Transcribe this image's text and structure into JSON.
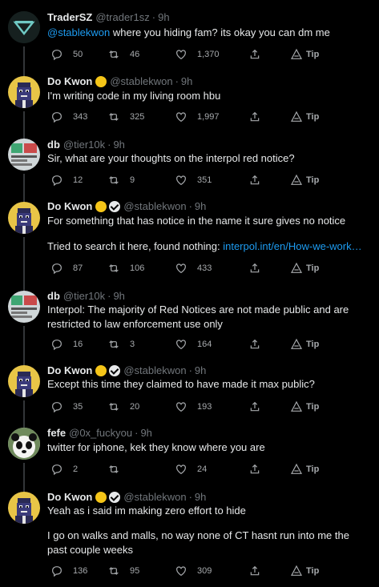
{
  "tweets": [
    {
      "name": "TraderSZ",
      "handle": "@trader1sz",
      "time": "9h",
      "avatar": "v-logo",
      "gold_badge": false,
      "verified": false,
      "mention": "@stablekwon",
      "text": " where you hiding fam? its okay you can dm me",
      "replies": "50",
      "retweets": "46",
      "likes": "1,370",
      "tip": "Tip"
    },
    {
      "name": "Do Kwon",
      "handle": "@stablekwon",
      "time": "9h",
      "avatar": "pixel-punk",
      "gold_badge": true,
      "verified": false,
      "text": "I'm writing code in my living room hbu",
      "replies": "343",
      "retweets": "325",
      "likes": "1,997",
      "tip": "Tip"
    },
    {
      "name": "db",
      "handle": "@tier10k",
      "time": "9h",
      "avatar": "db-screen",
      "text": "Sir, what are your thoughts on the interpol red notice?",
      "replies": "12",
      "retweets": "9",
      "likes": "351",
      "tip": "Tip"
    },
    {
      "name": "Do Kwon",
      "handle": "@stablekwon",
      "time": "9h",
      "avatar": "pixel-punk",
      "gold_badge": true,
      "verified": true,
      "text": "For something that has notice in the name it sure gives no notice",
      "text2": "Tried to search it here, found nothing: ",
      "link": "interpol.int/en/How-we-work…",
      "replies": "87",
      "retweets": "106",
      "likes": "433",
      "tip": "Tip"
    },
    {
      "name": "db",
      "handle": "@tier10k",
      "time": "9h",
      "avatar": "db-screen",
      "text": "Interpol: The majority of Red Notices are not made public and are restricted to law enforcement use only",
      "replies": "16",
      "retweets": "3",
      "likes": "164",
      "tip": "Tip"
    },
    {
      "name": "Do Kwon",
      "handle": "@stablekwon",
      "time": "9h",
      "avatar": "pixel-punk",
      "gold_badge": true,
      "verified": true,
      "text": "Except this time they claimed to have made it max public?",
      "replies": "35",
      "retweets": "20",
      "likes": "193",
      "tip": "Tip"
    },
    {
      "name": "fefe",
      "handle": "@0x_fuckyou",
      "time": "9h",
      "avatar": "panda",
      "text": "twitter for iphone, kek they know where you are",
      "replies": "2",
      "retweets": "",
      "likes": "24",
      "tip": "Tip"
    },
    {
      "name": "Do Kwon",
      "handle": "@stablekwon",
      "time": "9h",
      "avatar": "pixel-punk",
      "gold_badge": true,
      "verified": true,
      "text": "Yeah as i said im making zero effort to hide",
      "text2": "I go on walks and malls, no way none of CT hasnt run into me the past couple weeks",
      "replies": "136",
      "retweets": "95",
      "likes": "309",
      "tip": "Tip"
    }
  ],
  "colors": {
    "background": "#000000",
    "text": "#e7e9ea",
    "muted": "#71767b",
    "link": "#1d9bf0",
    "badge": "#f5c518"
  }
}
